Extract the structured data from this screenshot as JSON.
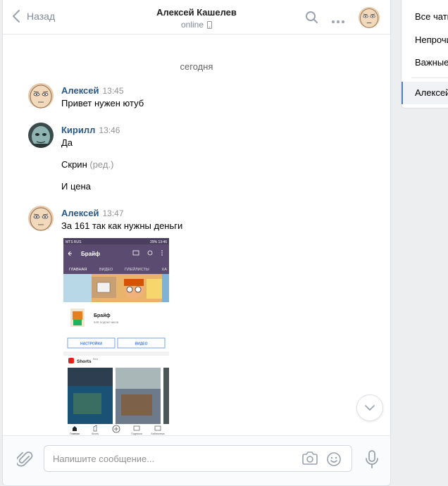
{
  "header": {
    "back_label": "Назад",
    "title": "Алексей Кашелев",
    "status": "online"
  },
  "date_separator": "сегодня",
  "messages": [
    {
      "author": "Алексей",
      "time": "13:45",
      "lines": [
        "Привет нужен ютуб"
      ]
    },
    {
      "author": "Кирилл",
      "time": "13:46",
      "lines": [
        "Да",
        "Скрин",
        "И цена"
      ],
      "edited_label": "(ред.)"
    },
    {
      "author": "Алексей",
      "time": "13:47",
      "lines": [
        "За 161 так как нужны деньги"
      ]
    }
  ],
  "attachment": {
    "statusbar_left": "MTS RUS",
    "statusbar_right": "29% 13:46",
    "app_title": "Брайф",
    "tabs": [
      "ГЛАВНАЯ",
      "ВИДЕО",
      "ПЛЕЙЛИСТЫ",
      "КА"
    ],
    "channel_name": "Брайф",
    "subscribers": "649 подписчиков",
    "button_settings": "НАСТРОЙКИ",
    "button_video": "ВИДЕО",
    "shorts_label": "Shorts",
    "shorts_beta": "Beta",
    "nav": [
      "Главная",
      "Shorts",
      "",
      "Подписки",
      "Библиотека"
    ]
  },
  "composer": {
    "placeholder": "Напишите сообщение..."
  },
  "right_panel": {
    "items": [
      "Все чаты",
      "Непрочитанные",
      "Важные"
    ],
    "active": "Алексей"
  },
  "colors": {
    "link": "#2a5885",
    "accent": "#5181b8",
    "muted": "#828a99"
  }
}
